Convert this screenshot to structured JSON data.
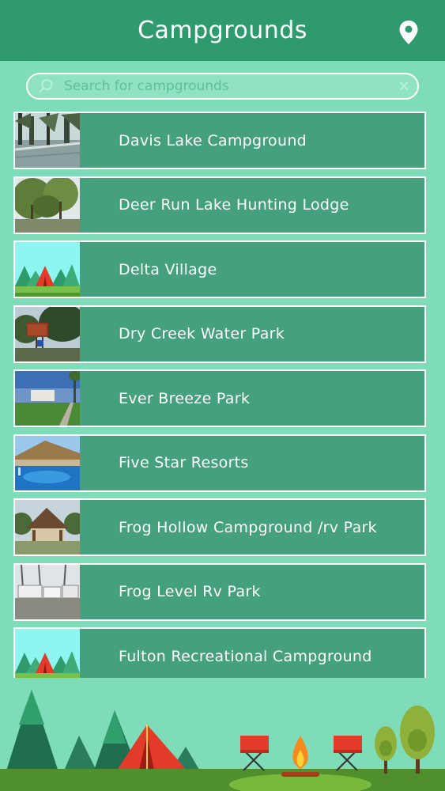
{
  "header": {
    "title": "Campgrounds",
    "location_icon": "map-pin-icon"
  },
  "search": {
    "placeholder": "Search for campgrounds",
    "value": "",
    "search_icon": "search-icon",
    "clear_icon": "clear-icon"
  },
  "campgrounds": [
    {
      "name": "Davis Lake Campground",
      "thumbnail": "lake-trees-photo"
    },
    {
      "name": "Deer Run Lake Hunting Lodge",
      "thumbnail": "willow-trees-photo"
    },
    {
      "name": "Delta Village",
      "thumbnail": "tent-placeholder-icon"
    },
    {
      "name": "Dry Creek Water Park",
      "thumbnail": "park-sign-photo"
    },
    {
      "name": "Ever Breeze Park",
      "thumbnail": "park-entrance-photo"
    },
    {
      "name": "Five Star Resorts",
      "thumbnail": "resort-pool-photo"
    },
    {
      "name": "Frog Hollow Campground /rv Park",
      "thumbnail": "gazebo-photo"
    },
    {
      "name": "Frog Level Rv Park",
      "thumbnail": "rv-lot-photo"
    },
    {
      "name": "Fulton Recreational Campground",
      "thumbnail": "tent-placeholder-icon"
    }
  ],
  "colors": {
    "background": "#7fdcb8",
    "header": "#2e9a6e",
    "list_item": "#45a07e",
    "border": "#ffffff"
  }
}
